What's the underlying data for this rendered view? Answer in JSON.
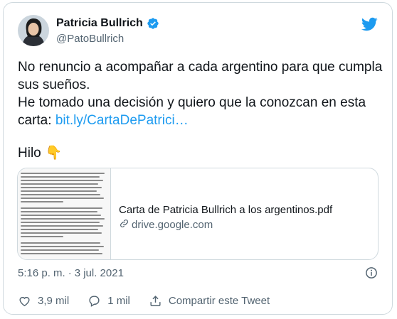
{
  "user": {
    "name": "Patricia Bullrich",
    "handle": "@PatoBullrich"
  },
  "tweet": {
    "line1": "No renuncio a acompañar a cada argentino para que cumpla sus sueños.",
    "line2_prefix": "He tomado una decisión y quiero que la conozcan en esta carta: ",
    "link": "bit.ly/CartaDePatrici…",
    "hilo": "Hilo",
    "hilo_emoji": "👇"
  },
  "preview": {
    "title": "Carta de Patricia Bullrich a los argentinos.pdf",
    "domain": "drive.google.com"
  },
  "meta": {
    "time": "5:16 p. m.",
    "separator": "·",
    "date": "3 jul. 2021"
  },
  "actions": {
    "likes": "3,9 mil",
    "replies": "1 mil",
    "share": "Compartir este Tweet"
  },
  "colors": {
    "accent": "#1d9bf0",
    "secondary_text": "#536471",
    "border": "#cfd9de"
  }
}
